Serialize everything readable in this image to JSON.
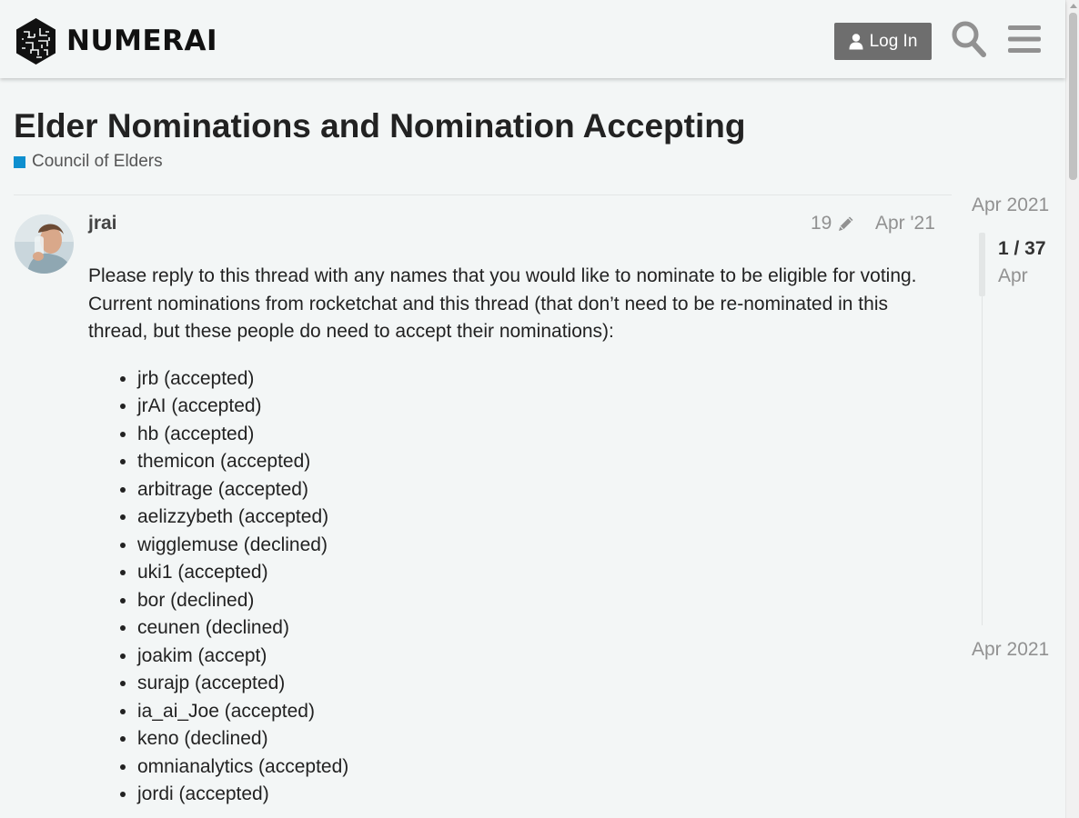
{
  "header": {
    "logo_text": "NUMERAI",
    "login_label": "Log In",
    "icons": {
      "login": "user-icon",
      "search": "search-icon",
      "menu": "hamburger-menu-icon"
    }
  },
  "topic": {
    "title": "Elder Nominations and Nomination Accepting",
    "category": "Council of Elders",
    "category_color": "#0e8fcf"
  },
  "post": {
    "username": "jrai",
    "edit_count": "19",
    "date": "Apr '21",
    "intro": "Please reply to this thread with any names that you would like to nominate to be eligible for voting. Current nominations from rocketchat and this thread (that don’t need to be re-nominated in this thread, but these people do need to accept their nominations):",
    "nominations": [
      "jrb (accepted)",
      "jrAI (accepted)",
      "hb (accepted)",
      "themicon (accepted)",
      "arbitrage (accepted)",
      "aelizzybeth (accepted)",
      "wigglemuse (declined)",
      "uki1 (accepted)",
      "bor (declined)",
      "ceunen (declined)",
      "joakim (accept)",
      "surajp (accepted)",
      "ia_ai_Joe (accepted)",
      "keno (declined)",
      "omnianalytics (accepted)",
      "jordi (accepted)"
    ]
  },
  "timeline": {
    "start_label": "Apr 2021",
    "position": "1 / 37",
    "position_sub": "Apr",
    "end_label": "Apr 2021"
  }
}
